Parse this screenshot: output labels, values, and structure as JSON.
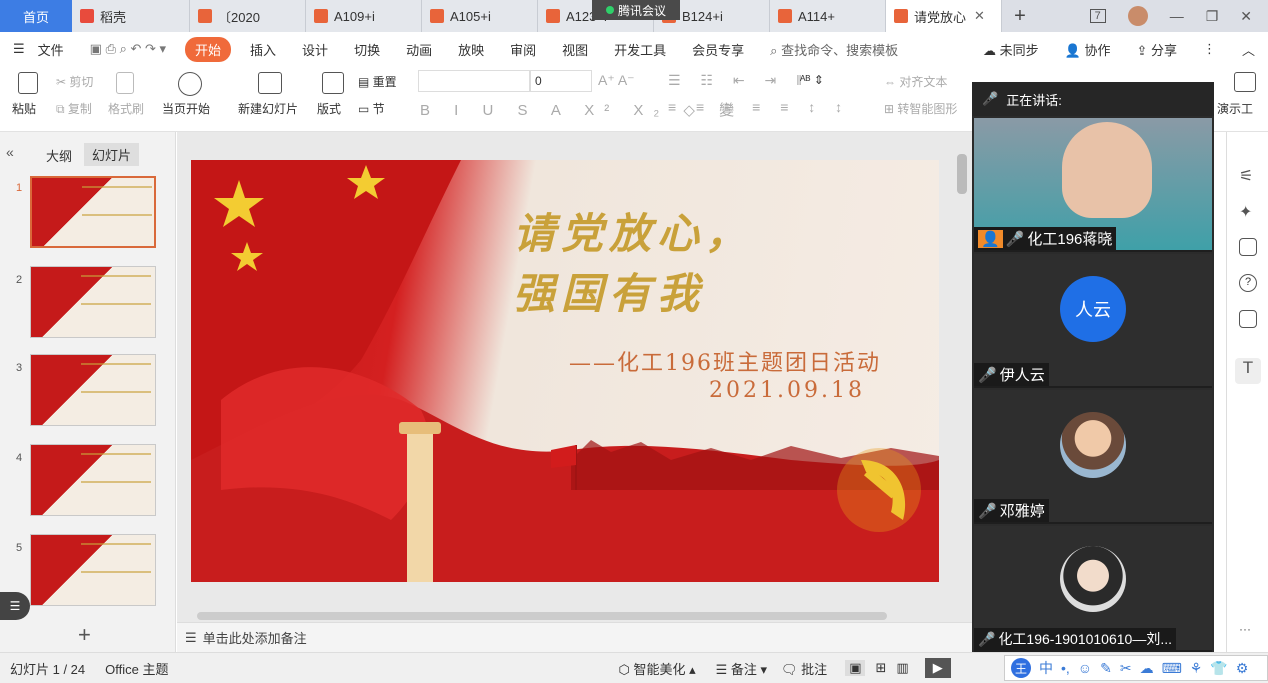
{
  "tabs": {
    "home": "首页",
    "items": [
      {
        "label": "稻壳",
        "color": "#e84b3c"
      },
      {
        "label": "〔2020",
        "color": "#e8643a"
      },
      {
        "label": "A109+i",
        "color": "#e8643a"
      },
      {
        "label": "A105+i",
        "color": "#e8643a"
      },
      {
        "label": "A123+i",
        "color": "#e8643a"
      },
      {
        "label": "B124+i",
        "color": "#e8643a"
      },
      {
        "label": "A114+",
        "color": "#e8643a"
      },
      {
        "label": "请党放心",
        "color": "#e8643a"
      }
    ],
    "active_close": "✕",
    "new_tab": "+",
    "window_badge": "7",
    "overlay": "腾讯会议"
  },
  "menu": {
    "file": "文件",
    "items": [
      "开始",
      "插入",
      "设计",
      "切换",
      "动画",
      "放映",
      "审阅",
      "视图",
      "开发工具",
      "会员专享"
    ],
    "search": "查找命令、搜索模板",
    "sync": "未同步",
    "collab": "协作",
    "share": "分享"
  },
  "ribbon": {
    "paste": "粘贴",
    "cut": "剪切",
    "copy": "复制",
    "format_painter": "格式刷",
    "from_current": "当页开始",
    "new_slide": "新建幻灯片",
    "layout": "版式",
    "reset": "重置",
    "section": "节",
    "font_size": "0",
    "align_text": "对齐文本",
    "smart_shape": "转智能图形",
    "present_tool": "演示工"
  },
  "left_pane": {
    "tab_outline": "大纲",
    "tab_slides": "幻灯片",
    "numbers": [
      "1",
      "2",
      "3",
      "4",
      "5"
    ],
    "add": "+"
  },
  "slide": {
    "title_line1": "请党放心，",
    "title_line2": "强国有我",
    "subtitle": "——化工196班主题团日活动",
    "date": "2021.09.18"
  },
  "notes_placeholder": "单击此处添加备注",
  "status": {
    "slide_count": "幻灯片 1 / 24",
    "theme": "Office 主题",
    "beautify": "智能美化",
    "notes": "备注",
    "comments": "批注"
  },
  "meeting": {
    "speaking_label": "正在讲话:",
    "participants": [
      {
        "name": "化工196蒋晓",
        "type": "video"
      },
      {
        "name": "伊人云",
        "type": "initials",
        "initials": "人云",
        "color": "#1f6fe6"
      },
      {
        "name": "邓雅婷",
        "type": "photo"
      },
      {
        "name": "化工196-1901010610—刘...",
        "type": "photo"
      }
    ]
  },
  "ime": {
    "logo": "王",
    "lang": "中"
  },
  "colors": {
    "accent_orange": "#f06a3a",
    "home_tab": "#3d7de4",
    "slide_red": "#c51a1a",
    "slide_gold": "#c9a13a",
    "subtitle_brown": "#c96b3a"
  }
}
